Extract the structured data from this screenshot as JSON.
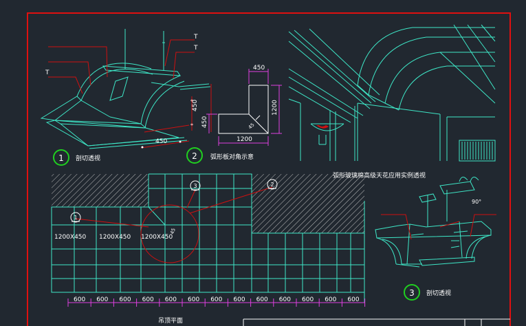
{
  "title_block": {
    "label_1": "剖切透视",
    "label_2": "弧形板对角示意",
    "label_3": "剖切透视",
    "caption_top_right": "弧形玻璃棉高级天花应用实例透视",
    "caption_bottom": "吊顶平面",
    "num_1": "1",
    "num_2": "2",
    "num_3": "3"
  },
  "detail_1": {
    "dim_450_top": "450",
    "dim_450_side": "450",
    "dim_450_bottom": "450",
    "label_t1": "T",
    "label_t2": "T",
    "label_t3": "T"
  },
  "detail_2": {
    "dim_top": "450",
    "dim_right": "1200",
    "dim_bottom": "1200",
    "dim_left": "450",
    "dim_angle": "45"
  },
  "detail_3": {
    "angle": "90°"
  },
  "plan": {
    "panel_1": "1200X450",
    "panel_2": "1200X450",
    "panel_3": "1200X450",
    "angle_45": "45",
    "callout_1": "1",
    "callout_2": "2",
    "callout_3": "3",
    "dims": [
      "600",
      "600",
      "600",
      "600",
      "600",
      "600",
      "600",
      "600",
      "600",
      "600",
      "600",
      "600",
      "600"
    ]
  },
  "colors": {
    "background": "#212830",
    "frame": "#e01010",
    "lines": "#3ee8c8",
    "dims": "#e040e0",
    "text": "#ffffff",
    "circle_green": "#20d020",
    "leader_red": "#d01010"
  }
}
